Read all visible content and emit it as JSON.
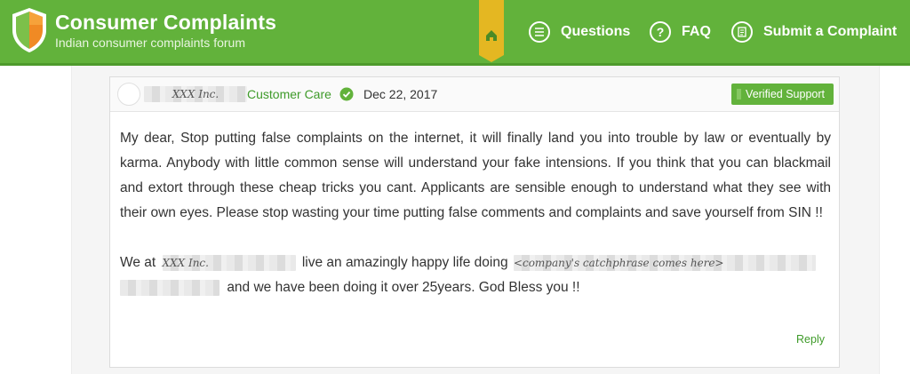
{
  "header": {
    "title": "Consumer Complaints",
    "subtitle": "Indian consumer complaints forum",
    "home_icon": "home-icon",
    "nav": [
      {
        "label": "Questions",
        "icon": "list-icon"
      },
      {
        "label": "FAQ",
        "icon": "question-icon"
      },
      {
        "label": "Submit a Complaint",
        "icon": "document-icon"
      }
    ]
  },
  "comment": {
    "author": "XXX Inc.",
    "role": "Customer Care",
    "date": "Dec 22, 2017",
    "badge": "Verified Support",
    "paragraph1": "My dear, Stop putting false complaints on the internet, it will finally land you into trouble by law or eventually by karma. Anybody with little common sense will understand your fake intensions. If you think that you can blackmail and extort through these cheap tricks you cant. Applicants are sensible enough to understand what they see with their own eyes. Please stop wasting your time putting false comments and complaints and save yourself from SIN !!",
    "p2_start": "We at",
    "p2_company": "XXX Inc.",
    "p2_mid": "live an amazingly happy life doing",
    "p2_phrase": "<company's catchphrase comes here>",
    "p2_end": "and we have been doing it over 25years. God Bless you !!",
    "reply": "Reply"
  },
  "colors": {
    "header_green": "#62b23b",
    "home_tab_yellow": "#e4b722",
    "link_green": "#3f9b2a",
    "text": "#333333"
  }
}
